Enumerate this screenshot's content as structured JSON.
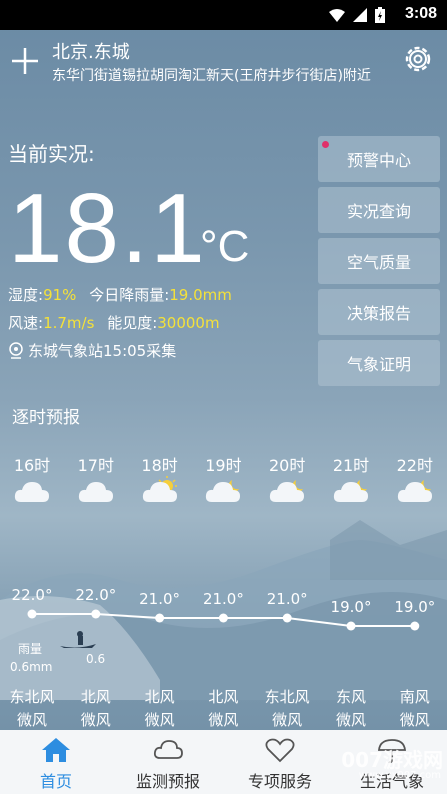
{
  "status_bar": {
    "time": "3:08"
  },
  "header": {
    "city": "北京.东城",
    "address": "东华门街道锡拉胡同淘汇新天(王府井步行街店)附近"
  },
  "current": {
    "label": "当前实况:",
    "temperature": "18.1",
    "unit": "°C",
    "humidity_label": "湿度:",
    "humidity_value": "91%",
    "rain_label": "今日降雨量:",
    "rain_value": "19.0mm",
    "wind_label": "风速:",
    "wind_value": "1.7m/s",
    "visibility_label": "能见度:",
    "visibility_value": "30000m",
    "station": "东城气象站15:05采集"
  },
  "side_buttons": [
    "预警中心",
    "实况查询",
    "空气质量",
    "决策报告",
    "气象证明"
  ],
  "hourly": {
    "title": "逐时预报",
    "hours": [
      {
        "time": "16时",
        "icon": "cloudy-icon",
        "temp": "22.0°",
        "wind_dir": "东北风",
        "wind_level": "微风"
      },
      {
        "time": "17时",
        "icon": "cloudy-icon",
        "temp": "22.0°",
        "wind_dir": "北风",
        "wind_level": "微风"
      },
      {
        "time": "18时",
        "icon": "partly-sunny-icon",
        "temp": "21.0°",
        "wind_dir": "北风",
        "wind_level": "微风"
      },
      {
        "time": "19时",
        "icon": "cloudy-night-icon",
        "temp": "21.0°",
        "wind_dir": "北风",
        "wind_level": "微风"
      },
      {
        "time": "20时",
        "icon": "cloudy-night-icon",
        "temp": "21.0°",
        "wind_dir": "东北风",
        "wind_level": "微风"
      },
      {
        "time": "21时",
        "icon": "cloudy-night-icon",
        "temp": "19.0°",
        "wind_dir": "东风",
        "wind_level": "微风"
      },
      {
        "time": "22时",
        "icon": "cloudy-night-icon",
        "temp": "19.0°",
        "wind_dir": "南风",
        "wind_level": "微风"
      }
    ],
    "rain_title": "雨量",
    "rain_values": [
      "0.6mm",
      "0.6"
    ]
  },
  "tabs": [
    {
      "label": "首页",
      "icon": "home-icon",
      "active": true
    },
    {
      "label": "监测预报",
      "icon": "cloud-icon",
      "active": false
    },
    {
      "label": "专项服务",
      "icon": "heart-icon",
      "active": false
    },
    {
      "label": "生活气象",
      "icon": "umbrella-icon",
      "active": false
    }
  ],
  "watermark": {
    "text": "007游戏网",
    "url": "www.yx007.com"
  },
  "colors": {
    "highlight": "#f4e13a",
    "active_tab": "#2d8de0",
    "warn_dot": "#e0306a"
  }
}
